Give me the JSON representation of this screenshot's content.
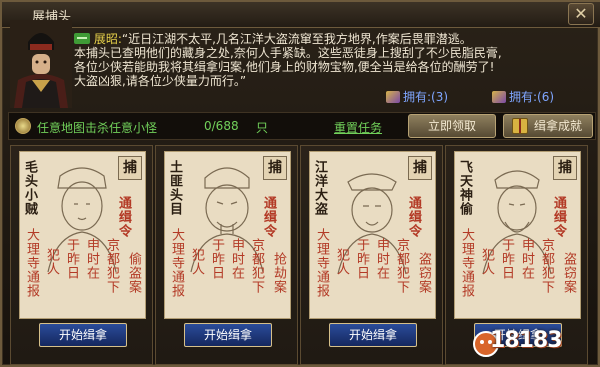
{
  "window": {
    "title": "展捕头",
    "close_icon": "close-icon"
  },
  "dialogue": {
    "speaker": "展昭:",
    "lines": [
      "“近日江湖不太平,几名江洋大盗流窜至我方地界,作案后畏罪潜逃。",
      "本捕头已查明他们的藏身之处,奈何人手紧缺。这些恶徒身上搜刮了不少民脂民膏,",
      "各位少侠若能助我将其缉拿归案,他们身上的财物宝物,便全当是给各位的酬劳了!",
      "大盗凶狠,请各位少侠量力而行。”"
    ],
    "owned": [
      {
        "label": "拥有:(3)",
        "icon": "token-icon"
      },
      {
        "label": "拥有:(6)",
        "icon": "token-icon"
      }
    ]
  },
  "task_bar": {
    "task": "任意地图击杀任意小怪",
    "progress": "0/688",
    "unit": "只",
    "reset": "重置任务",
    "claim": "立即领取",
    "achievement": "缉拿成就"
  },
  "posters": [
    {
      "name": "毛头小贼",
      "stamp": "捕",
      "order": "通缉令",
      "crime": "偷盗案",
      "cols": [
        "京都犯下",
        "申时在",
        "于昨日",
        "犯人",
        "大理寺通报"
      ],
      "button": "开始缉拿"
    },
    {
      "name": "土匪头目",
      "stamp": "捕",
      "order": "通缉令",
      "crime": "抢劫案",
      "cols": [
        "京都犯下",
        "申时在",
        "于昨日",
        "犯人",
        "大理寺通报"
      ],
      "button": "开始缉拿"
    },
    {
      "name": "江洋大盗",
      "stamp": "捕",
      "order": "通缉令",
      "crime": "盗窃案",
      "cols": [
        "京都犯下",
        "申时在",
        "于昨日",
        "犯人",
        "大理寺通报"
      ],
      "button": "开始缉拿"
    },
    {
      "name": "飞天神偷",
      "stamp": "捕",
      "order": "通缉令",
      "crime": "盗窃案",
      "cols": [
        "京都犯下",
        "申时在",
        "于昨日",
        "犯人",
        "大理寺通报"
      ],
      "button": "开始缉拿"
    }
  ],
  "watermark": "18183",
  "colors": {
    "accent_green": "#71d05a",
    "stamp_red": "#b33a26",
    "owned_blue": "#7fa6ff",
    "button_blue": "#2b4c9a"
  }
}
